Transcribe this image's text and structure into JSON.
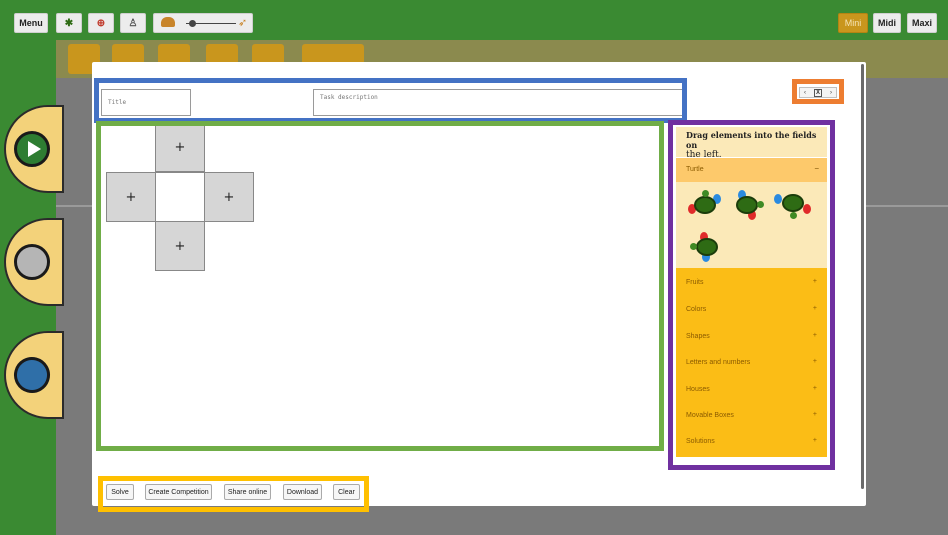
{
  "topbar": {
    "menu_label": "Menu",
    "mini_label": "Mini",
    "midi_label": "Midi",
    "maxi_label": "Maxi",
    "icons": [
      "turtle-icon",
      "flag-icon",
      "person-icon",
      "speed-slider"
    ]
  },
  "modal": {
    "title_placeholder": "Title",
    "description_placeholder": "Task description",
    "close_label": "X"
  },
  "grid": {
    "add_symbol": "+"
  },
  "palette": {
    "heading_line1": "Drag elements into the fields on",
    "heading_line2": "the left.",
    "turtle_section": {
      "label": "Turtle",
      "toggle": "−"
    },
    "categories": [
      {
        "label": "Fruits",
        "toggle": "+"
      },
      {
        "label": "Colors",
        "toggle": "+"
      },
      {
        "label": "Shapes",
        "toggle": "+"
      },
      {
        "label": "Letters and numbers",
        "toggle": "+"
      },
      {
        "label": "Houses",
        "toggle": "+"
      },
      {
        "label": "Movable Boxes",
        "toggle": "+"
      },
      {
        "label": "Solutions",
        "toggle": "+"
      }
    ]
  },
  "actions": {
    "solve": "Solve",
    "create_competition": "Create Competition",
    "share_online": "Share online",
    "download": "Download",
    "clear": "Clear"
  },
  "highlight_colors": {
    "header": "#4472c4",
    "close": "#ed7d31",
    "grid": "#70ad47",
    "palette": "#7030a0",
    "actions": "#ffc000"
  }
}
